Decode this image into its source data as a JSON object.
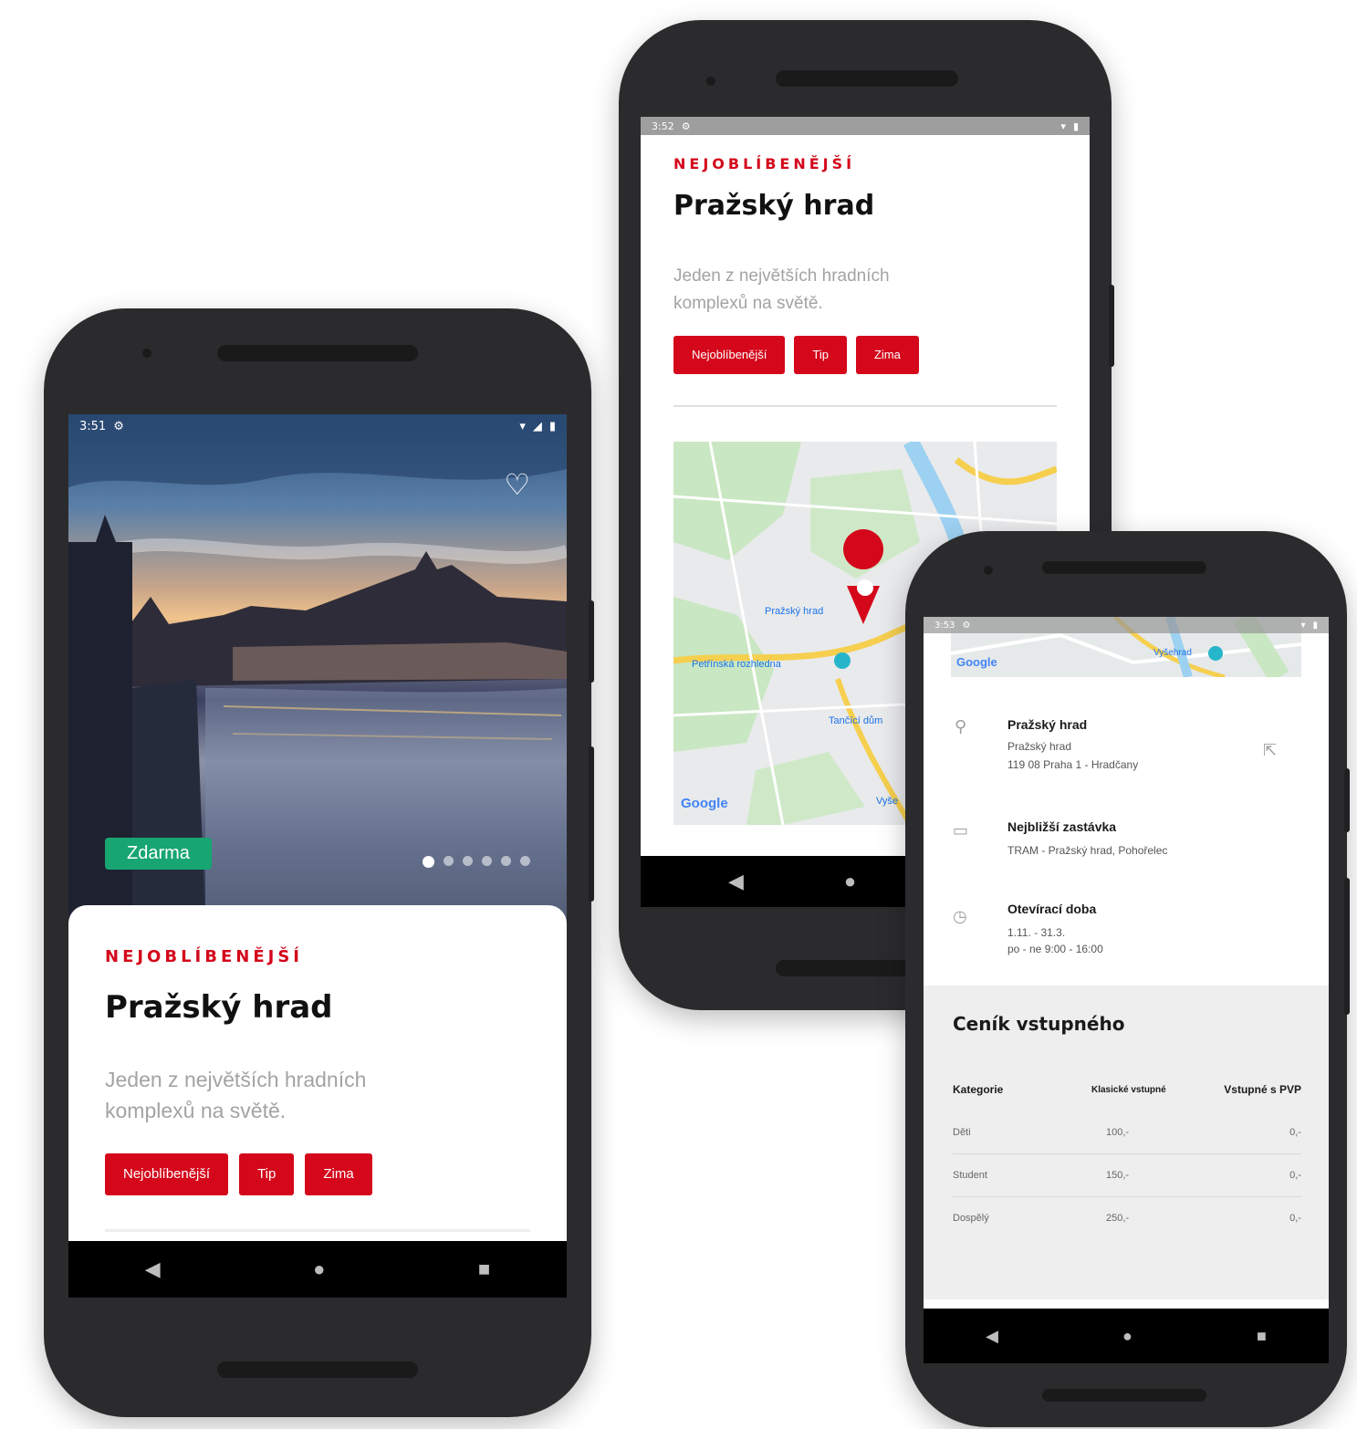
{
  "phone_left": {
    "status": {
      "time": "3:51",
      "settings_icon": "gear-icon"
    },
    "hero": {
      "badge": "Zdarma",
      "favorite_icon": "heart-outline-icon",
      "carousel_pages": 6,
      "carousel_active": 1
    },
    "card": {
      "eyebrow": "NEJOBLÍBENĚJŠÍ",
      "title": "Pražský hrad",
      "description_line1": "Jeden z největších hradních",
      "description_line2": "komplexů na světě.",
      "tags": [
        "Nejoblíbenější",
        "Tip",
        "Zima"
      ]
    },
    "nav": {
      "back": "◀",
      "home": "●",
      "recents": "■"
    }
  },
  "phone_middle": {
    "status": {
      "time": "3:52"
    },
    "eyebrow": "NEJOBLÍBENĚJŠÍ",
    "title": "Pražský hrad",
    "description_line1": "Jeden z největších hradních",
    "description_line2": "komplexů na světě.",
    "tags": [
      "Nejoblíbenější",
      "Tip",
      "Zima"
    ],
    "map": {
      "labels": [
        "Pražský hrad",
        "Petřínská rozhledna",
        "Tančící dům",
        "Vyše"
      ],
      "google": "Google"
    },
    "nav": {
      "back": "◀",
      "home": "●"
    }
  },
  "phone_right": {
    "status": {
      "time": "3:53"
    },
    "map": {
      "google": "Google",
      "label": "Vyšehrad"
    },
    "address": {
      "heading": "Pražský hrad",
      "line1": "Pražský hrad",
      "line2": "119 08 Praha 1 - Hradčany"
    },
    "stop": {
      "heading": "Nejbližší zastávka",
      "line1": "TRAM - Pražský hrad, Pohořelec"
    },
    "hours": {
      "heading": "Otevírací doba",
      "line1": "1.11. - 31.3.",
      "line2": "po - ne 9:00 - 16:00"
    },
    "prices": {
      "heading": "Ceník vstupného",
      "columns": [
        "Kategorie",
        "Klasické vstupné",
        "Vstupné s PVP"
      ],
      "rows": [
        [
          "Děti",
          "100,-",
          "0,-"
        ],
        [
          "Student",
          "150,-",
          "0,-"
        ],
        [
          "Dospělý",
          "250,-",
          "0,-"
        ]
      ]
    },
    "nav": {
      "back": "◀",
      "home": "●",
      "recents": "■"
    }
  },
  "colors": {
    "accent": "#d4071b",
    "badge": "#17a572",
    "phone": "#2b2b2d"
  }
}
